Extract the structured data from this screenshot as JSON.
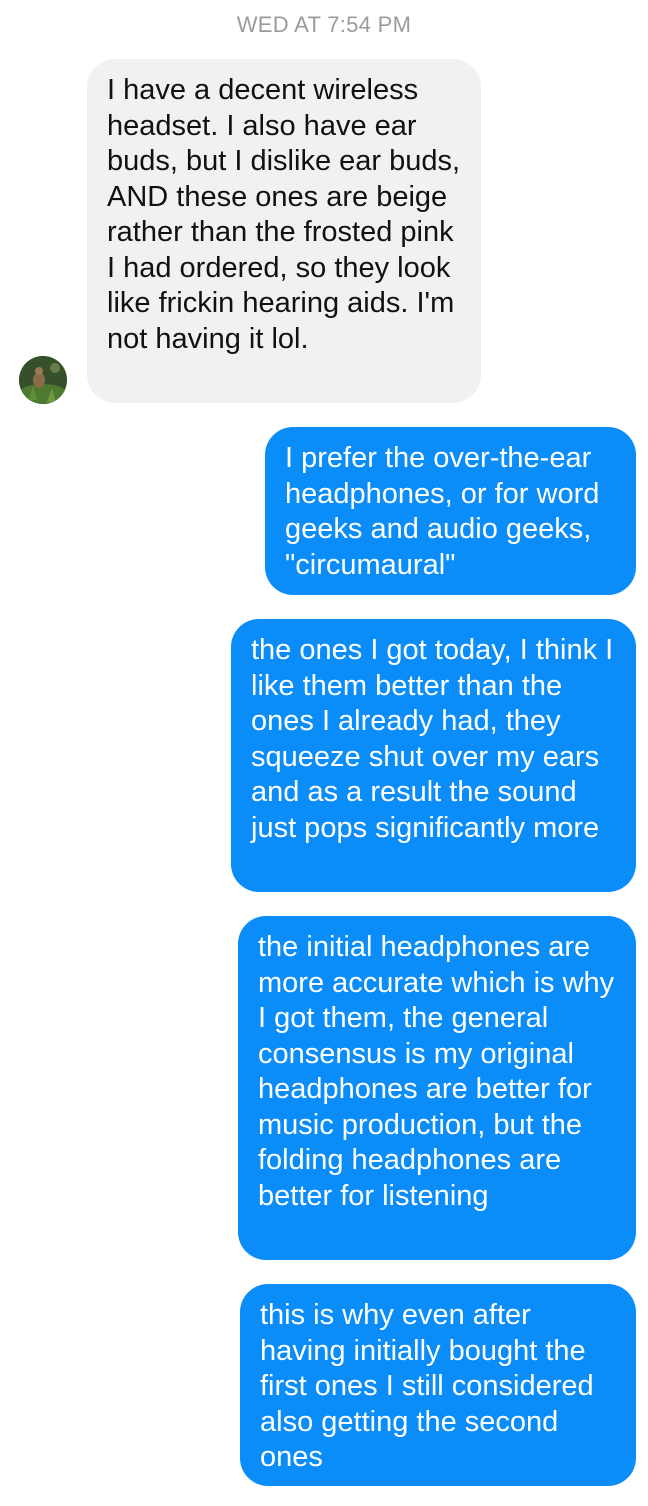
{
  "conversation": {
    "timestamp": "WED AT 7:54 PM",
    "messages": [
      {
        "sender": "other",
        "text": "I have a decent wireless headset. I also have ear buds, but I dislike ear buds, AND these ones are beige rather than the frosted pink I had ordered, so they look like frickin hearing aids. I'm not having it lol."
      },
      {
        "sender": "me",
        "text": "I prefer the over-the-ear headphones, or for word geeks and audio geeks, \"circumaural\""
      },
      {
        "sender": "me",
        "text": "the ones I got today, I think I like them better than the ones I already had, they squeeze shut over my ears and as a result the sound just pops significantly more"
      },
      {
        "sender": "me",
        "text": "the initial headphones are more accurate which is why I got them, the general consensus is my original headphones are better for music production, but the folding headphones are better for listening"
      },
      {
        "sender": "me",
        "text": "this is why even after having initially bought the first ones I still considered also getting the second ones"
      }
    ]
  },
  "colors": {
    "incoming_bubble": "#f1f1f1",
    "outgoing_bubble": "#0a8df8",
    "timestamp_text": "#9b9b9b"
  },
  "icons": {
    "avatar": "contact-avatar-photo"
  }
}
